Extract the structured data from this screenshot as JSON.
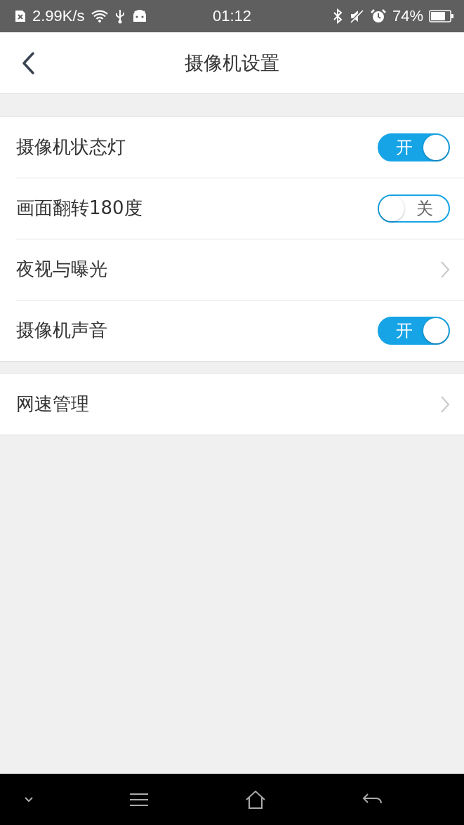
{
  "status_bar": {
    "speed": "2.99K/s",
    "time": "01:12",
    "battery": "74%"
  },
  "header": {
    "title": "摄像机设置"
  },
  "groups": [
    {
      "rows": [
        {
          "kind": "toggle",
          "label": "摄像机状态灯",
          "on": true,
          "toggle_text": "开"
        },
        {
          "kind": "toggle",
          "label": "画面翻转180度",
          "on": false,
          "toggle_text": "关"
        },
        {
          "kind": "link",
          "label": "夜视与曝光"
        },
        {
          "kind": "toggle",
          "label": "摄像机声音",
          "on": true,
          "toggle_text": "开"
        }
      ]
    },
    {
      "rows": [
        {
          "kind": "link",
          "label": "网速管理"
        }
      ]
    }
  ]
}
